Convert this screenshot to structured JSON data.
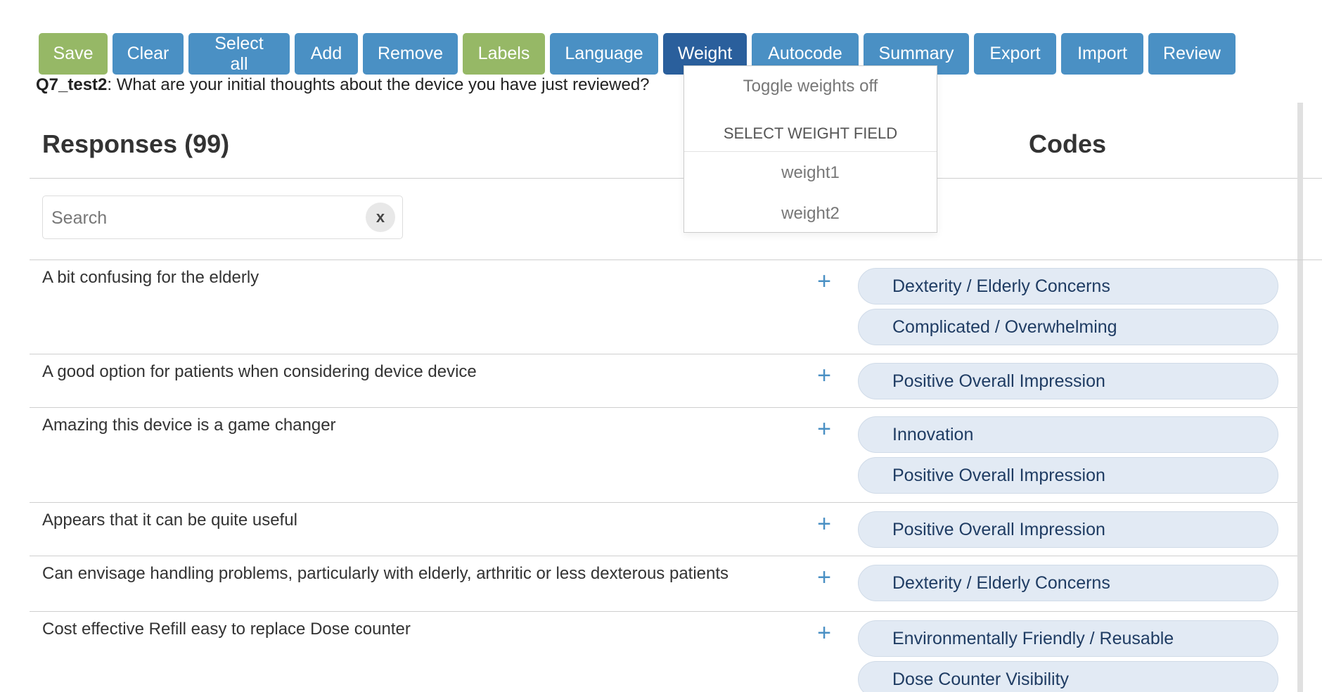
{
  "toolbar": {
    "buttons": [
      {
        "label": "Save",
        "style": "green"
      },
      {
        "label": "Clear",
        "style": "blue"
      },
      {
        "label": "Select all",
        "style": "blue"
      },
      {
        "label": "Add",
        "style": "blue"
      },
      {
        "label": "Remove",
        "style": "blue"
      },
      {
        "label": "Labels",
        "style": "green"
      },
      {
        "label": "Language",
        "style": "blue"
      },
      {
        "label": "Weight",
        "style": "active"
      },
      {
        "label": "Autocode",
        "style": "blue"
      },
      {
        "label": "Summary",
        "style": "blue"
      },
      {
        "label": "Export",
        "style": "blue"
      },
      {
        "label": "Import",
        "style": "blue"
      },
      {
        "label": "Review",
        "style": "blue"
      }
    ]
  },
  "question": {
    "id": "Q7_test2",
    "text": ": What are your initial thoughts about the device you have just reviewed?"
  },
  "responses": {
    "heading": "Responses (99)",
    "search_placeholder": "Search",
    "clear_label": "x"
  },
  "codes": {
    "heading": "Codes"
  },
  "weight_menu": {
    "toggle_label": "Toggle weights off",
    "section_header": "SELECT WEIGHT FIELD",
    "fields": [
      "weight1",
      "weight2"
    ]
  },
  "rows": [
    {
      "text": "A bit confusing for the elderly",
      "codes": [
        "Dexterity / Elderly Concerns",
        "Complicated / Overwhelming"
      ]
    },
    {
      "text": "A good option for patients when considering device device",
      "codes": [
        "Positive Overall Impression"
      ]
    },
    {
      "text": "Amazing this device is a game changer",
      "codes": [
        "Innovation",
        "Positive Overall Impression"
      ]
    },
    {
      "text": "Appears that it can be quite useful",
      "codes": [
        "Positive Overall Impression"
      ]
    },
    {
      "text": "Can envisage handling problems, particularly with elderly, arthritic or less dexterous patients",
      "codes": [
        "Dexterity / Elderly Concerns"
      ]
    },
    {
      "text": "Cost effective Refill easy to replace Dose counter",
      "codes": [
        "Environmentally Friendly / Reusable",
        "Dose Counter Visibility"
      ]
    }
  ],
  "colors": {
    "button_blue": "#4a90c4",
    "button_green": "#96b866",
    "button_active": "#2a5f9c",
    "pill_bg": "#e2eaf4",
    "pill_text": "#1f3c63"
  }
}
